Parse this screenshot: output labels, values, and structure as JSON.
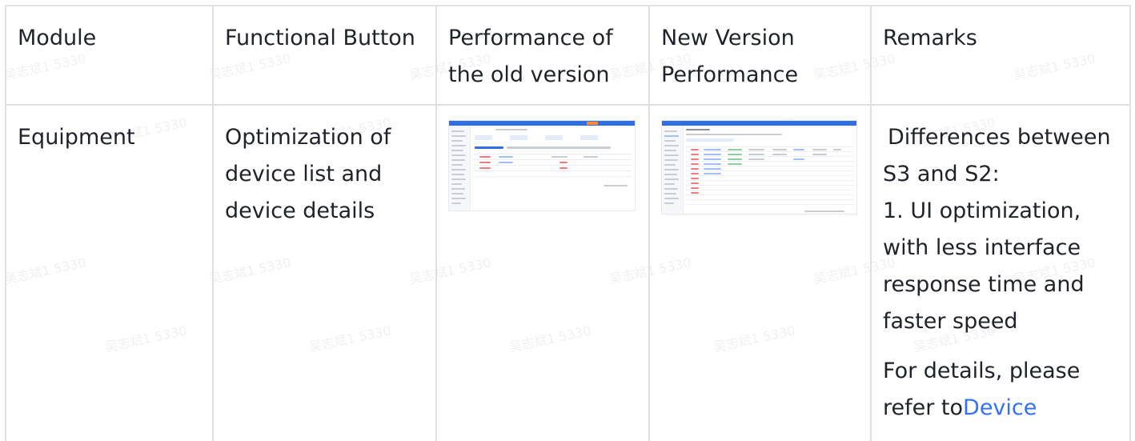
{
  "table": {
    "headers": [
      "Module",
      "Functional Button",
      "Performance of the old version",
      "New Version Performance",
      "Remarks"
    ],
    "header_lines": {
      "col3": [
        "Performance of",
        "the old version"
      ],
      "col4": [
        "New Version",
        "Performance"
      ]
    },
    "rows": [
      {
        "module": "Equipment",
        "functional_button_lines": [
          "Optimization of",
          "device list and",
          "device details"
        ],
        "old_version_image": "old-version-device-list-screenshot",
        "new_version_image": "new-version-device-list-screenshot",
        "remarks": {
          "lines": [
            "Differences between",
            "S3 and S2:",
            "1. UI optimization,",
            "with less interface",
            "response time and",
            "faster speed"
          ],
          "details_prefix": "For details, please",
          "details_refer": "refer to",
          "link_text": "Device"
        }
      }
    ]
  },
  "watermark": "吴志斌1 5330",
  "colors": {
    "border": "#dee0e3",
    "text": "#1f2329",
    "link": "#3370ff",
    "thumb_accent": "#2f6ee6"
  }
}
